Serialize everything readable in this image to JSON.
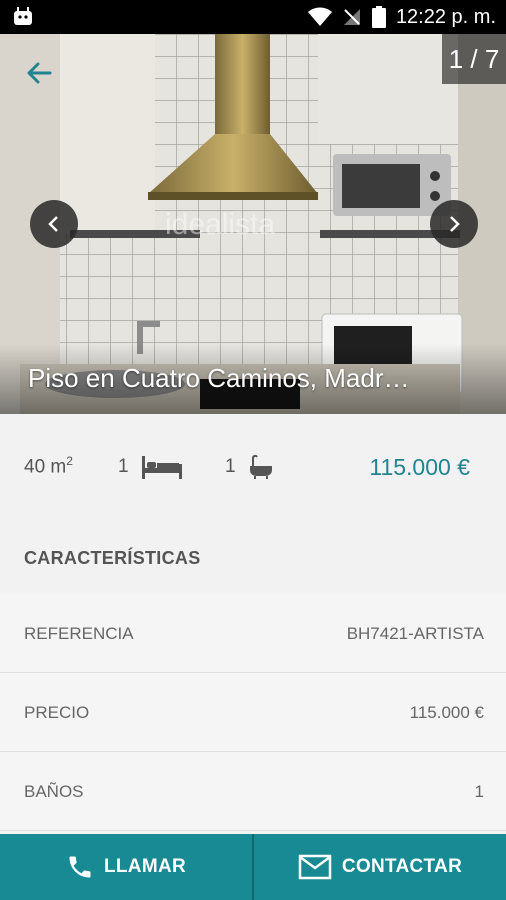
{
  "status_bar": {
    "time": "12:22 p. m."
  },
  "gallery": {
    "counter": "1 / 7",
    "watermark": "idealista",
    "title": "Piso en Cuatro Caminos, Madr…"
  },
  "specs": {
    "area_value": "40 m",
    "area_unit_sup": "2",
    "rooms": "1",
    "baths": "1",
    "price": "115.000 €"
  },
  "characteristics": {
    "header": "CARACTERÍSTICAS",
    "rows": [
      {
        "label": "REFERENCIA",
        "value": "BH7421-ARTISTA"
      },
      {
        "label": "PRECIO",
        "value": "115.000 €"
      },
      {
        "label": "BAÑOS",
        "value": "1"
      }
    ]
  },
  "actions": {
    "call_label": "LLAMAR",
    "contact_label": "CONTACTAR"
  },
  "icons": {
    "back": "arrow-left-icon",
    "prev": "chevron-left-icon",
    "next": "chevron-right-icon",
    "bed": "bed-icon",
    "bath": "bathtub-icon",
    "phone": "phone-icon",
    "mail": "mail-icon"
  },
  "colors": {
    "accent": "#22848f",
    "action_bar": "#178a93"
  }
}
